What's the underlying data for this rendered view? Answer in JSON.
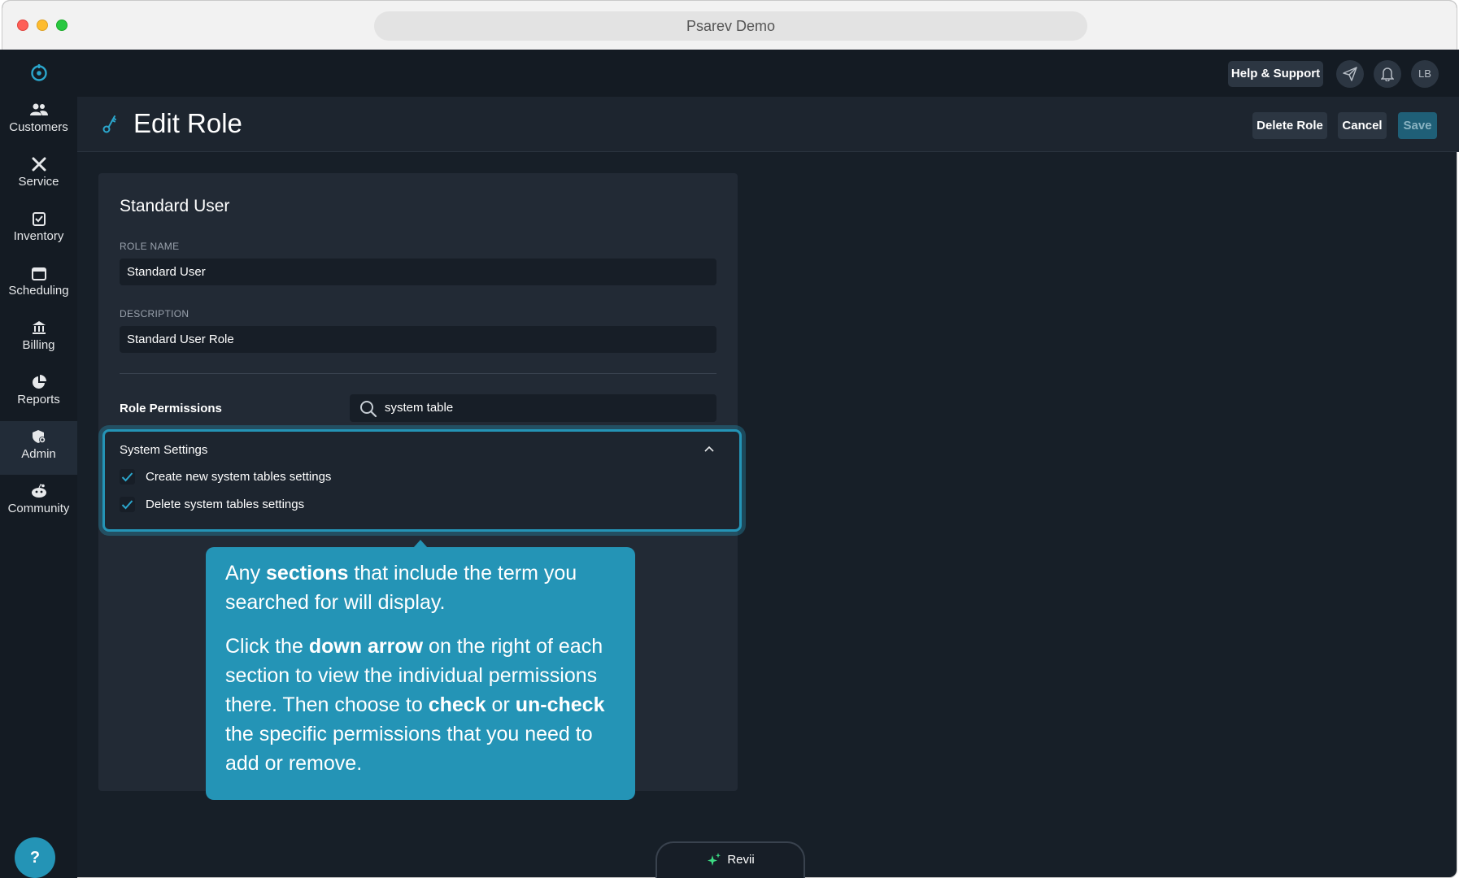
{
  "window": {
    "url_title": "Psarev Demo"
  },
  "sidebar": {
    "items": [
      {
        "label": "Customers",
        "icon": "users-icon"
      },
      {
        "label": "Service",
        "icon": "tools-icon"
      },
      {
        "label": "Inventory",
        "icon": "clipboard-check-icon"
      },
      {
        "label": "Scheduling",
        "icon": "calendar-icon"
      },
      {
        "label": "Billing",
        "icon": "bank-icon"
      },
      {
        "label": "Reports",
        "icon": "pie-chart-icon"
      },
      {
        "label": "Admin",
        "icon": "shield-gear-icon",
        "active": true
      },
      {
        "label": "Community",
        "icon": "community-icon"
      }
    ],
    "help_label": "?"
  },
  "topbar": {
    "help_support_label": "Help & Support",
    "avatar_initials": "LB"
  },
  "header": {
    "title": "Edit Role",
    "delete_label": "Delete Role",
    "cancel_label": "Cancel",
    "save_label": "Save"
  },
  "role": {
    "heading": "Standard User",
    "name_label": "ROLE NAME",
    "name_value": "Standard User",
    "description_label": "DESCRIPTION",
    "description_value": "Standard User Role",
    "permissions_label": "Role Permissions",
    "search_value": "system table"
  },
  "section": {
    "title": "System Settings",
    "permissions": [
      {
        "label": "Create new system tables settings",
        "checked": true
      },
      {
        "label": "Delete system tables settings",
        "checked": true
      }
    ]
  },
  "tooltip": {
    "p1_a": "Any ",
    "p1_b": "sections",
    "p1_c": " that include the term you searched for will display.",
    "p2_a": "Click the ",
    "p2_b": "down arrow",
    "p2_c": " on the right of each section to view the individual permissions there. Then choose to ",
    "p2_d": "check",
    "p2_e": " or ",
    "p2_f": "un-check",
    "p2_g": " the specific permissions that you need to add or remove."
  },
  "assistant": {
    "label": "Revii"
  },
  "colors": {
    "accent": "#2494b6",
    "background": "#171f28",
    "panel": "#222a35"
  }
}
